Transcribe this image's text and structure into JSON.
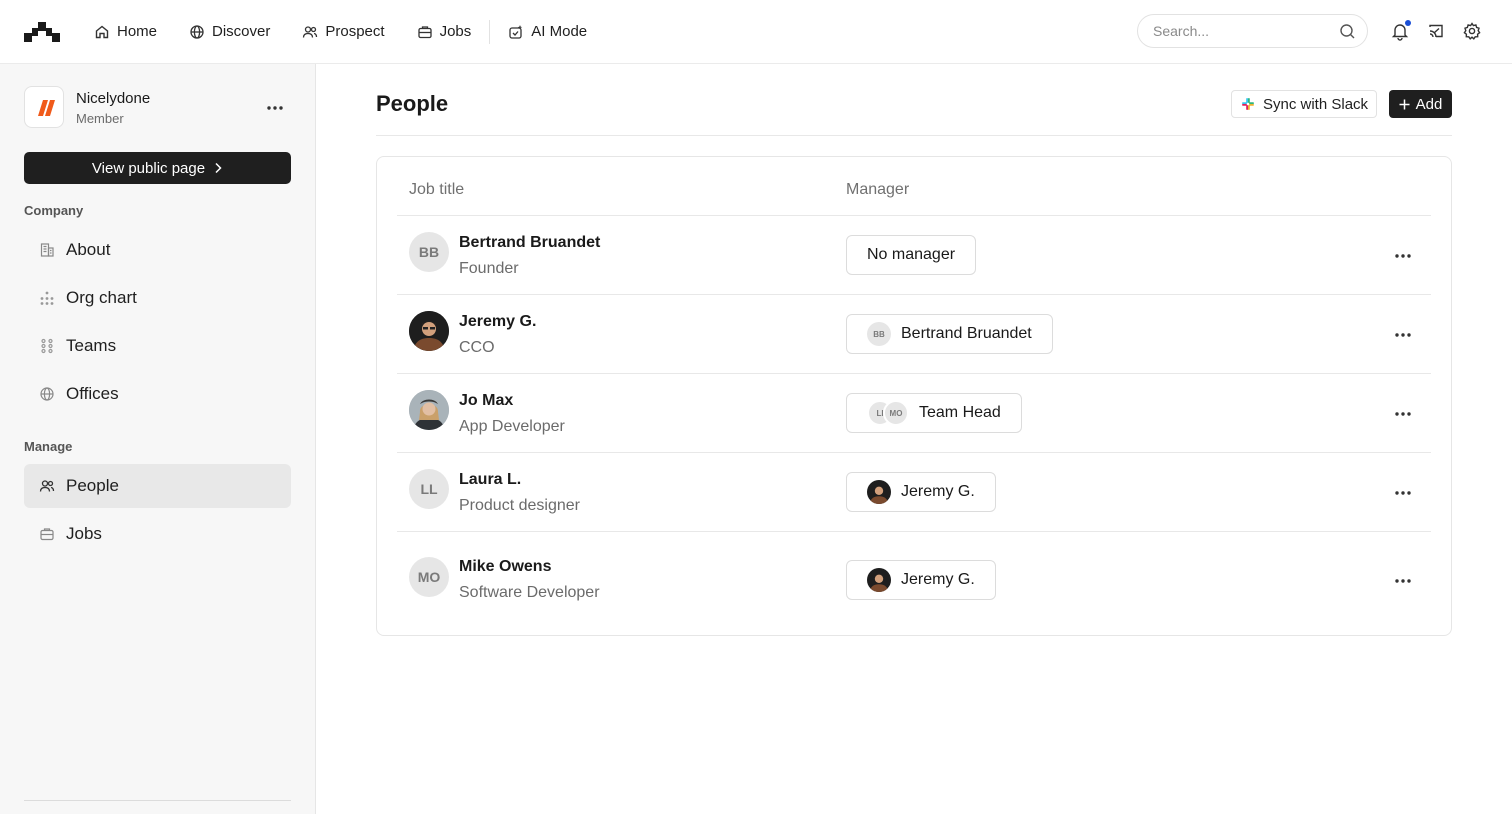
{
  "nav": {
    "items": [
      {
        "label": "Home",
        "icon": "home-icon"
      },
      {
        "label": "Discover",
        "icon": "globe-icon"
      },
      {
        "label": "Prospect",
        "icon": "users-icon"
      },
      {
        "label": "Jobs",
        "icon": "briefcase-icon"
      },
      {
        "label": "AI Mode",
        "icon": "ai-sparkle-icon"
      }
    ],
    "search_placeholder": "Search..."
  },
  "sidebar": {
    "org_name": "Nicelydone",
    "org_role": "Member",
    "view_public_label": "View public page",
    "company_title": "Company",
    "company_items": [
      {
        "label": "About",
        "icon": "building-icon"
      },
      {
        "label": "Org chart",
        "icon": "org-chart-icon"
      },
      {
        "label": "Teams",
        "icon": "teams-icon"
      },
      {
        "label": "Offices",
        "icon": "globe-icon"
      }
    ],
    "manage_title": "Manage",
    "manage_items": [
      {
        "label": "People",
        "icon": "users-icon",
        "active": true
      },
      {
        "label": "Jobs",
        "icon": "briefcase-icon",
        "active": false
      }
    ]
  },
  "main": {
    "title": "People",
    "sync_label": "Sync with Slack",
    "add_label": "Add",
    "columns": {
      "job_title": "Job title",
      "manager": "Manager"
    },
    "rows": [
      {
        "name": "Bertrand Bruandet",
        "title": "Founder",
        "initials": "BB",
        "manager": "No manager",
        "manager_initials": ""
      },
      {
        "name": "Jeremy G.",
        "title": "CCO",
        "initials": "",
        "manager": "Bertrand Bruandet",
        "manager_initials": "BB"
      },
      {
        "name": "Jo Max",
        "title": "App Developer",
        "initials": "",
        "manager": "Team Head",
        "manager_initials": [
          "LI",
          "MO"
        ]
      },
      {
        "name": "Laura L.",
        "title": "Product designer",
        "initials": "LL",
        "manager": "Jeremy G.",
        "manager_initials": ""
      },
      {
        "name": "Mike Owens",
        "title": "Software Developer",
        "initials": "MO",
        "manager": "Jeremy G.",
        "manager_initials": ""
      }
    ]
  },
  "colors": {
    "accent_dark": "#1f1f1f",
    "brand_orange": "#f05a1a",
    "notification_blue": "#1a4fd6"
  }
}
